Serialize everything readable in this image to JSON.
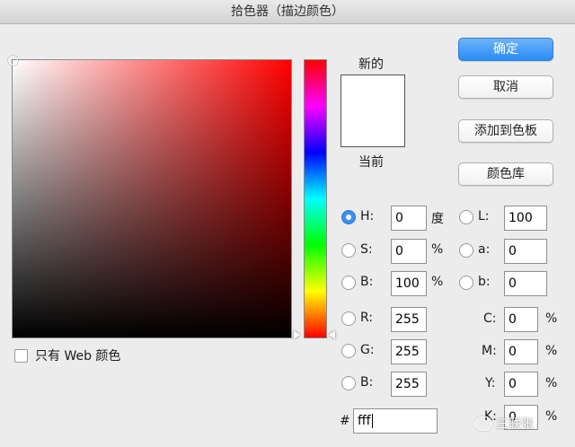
{
  "window": {
    "title": "拾色器（描边颜色）"
  },
  "picker": {
    "web_only_label": "只有 Web 颜色"
  },
  "preview": {
    "new_label": "新的",
    "current_label": "当前",
    "new_color": "#ffffff",
    "current_color": "#ffffff"
  },
  "buttons": {
    "ok": "确定",
    "cancel": "取消",
    "add_swatch": "添加到色板",
    "libraries": "颜色库"
  },
  "hsb": {
    "h": {
      "label": "H:",
      "value": "0",
      "unit": "度",
      "selected": true
    },
    "s": {
      "label": "S:",
      "value": "0",
      "unit": "%"
    },
    "b": {
      "label": "B:",
      "value": "100",
      "unit": "%"
    }
  },
  "rgb": {
    "r": {
      "label": "R:",
      "value": "255"
    },
    "g": {
      "label": "G:",
      "value": "255"
    },
    "b": {
      "label": "B:",
      "value": "255"
    }
  },
  "lab": {
    "l": {
      "label": "L:",
      "value": "100"
    },
    "a": {
      "label": "a:",
      "value": "0"
    },
    "b": {
      "label": "b:",
      "value": "0"
    }
  },
  "cmyk": {
    "c": {
      "label": "C:",
      "value": "0",
      "unit": "%"
    },
    "m": {
      "label": "M:",
      "value": "0",
      "unit": "%"
    },
    "y": {
      "label": "Y:",
      "value": "0",
      "unit": "%"
    },
    "k": {
      "label": "K:",
      "value": "0",
      "unit": "%"
    }
  },
  "hex": {
    "label": "#",
    "value": "fff"
  },
  "watermark": {
    "text": "三联张"
  },
  "colors": {
    "accent": "#3b8ff0",
    "hue_base": "#ff0000"
  }
}
